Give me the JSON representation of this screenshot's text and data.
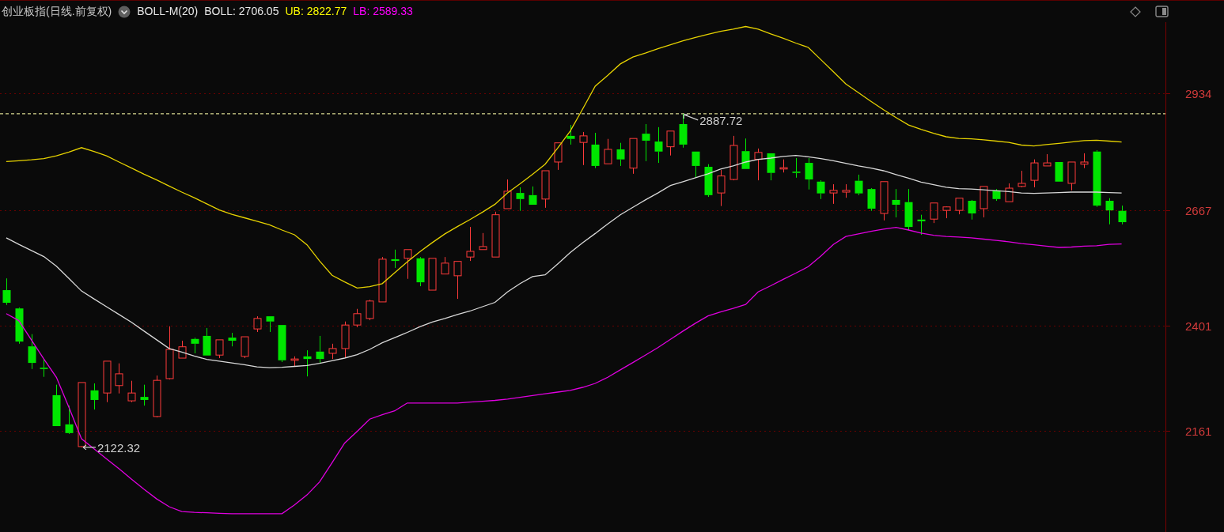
{
  "header": {
    "title": "创业板指(日线.前复权)",
    "indicator": "BOLL-M(20)",
    "readings": [
      {
        "text": "BOLL: 2706.05",
        "color": "#e8e8e8"
      },
      {
        "text": "UB: 2822.77",
        "color": "#ffff00"
      },
      {
        "text": "LB: 2589.33",
        "color": "#ff00ff"
      }
    ]
  },
  "chart": {
    "chart_data": {
      "type": "candlestick",
      "ylim": [
        1928,
        3098
      ],
      "yticks": [
        2161,
        2401,
        2667,
        2934
      ],
      "grid": true,
      "categories": [
        null,
        null,
        null,
        null,
        null,
        null,
        null,
        null,
        null,
        null,
        null,
        null,
        null,
        null,
        null,
        null,
        null,
        null,
        null,
        null,
        null,
        null,
        null,
        null,
        null,
        null,
        null,
        null,
        null,
        null,
        null,
        null,
        null,
        null,
        null,
        null,
        null,
        null,
        null,
        null,
        null,
        null,
        null,
        null,
        null,
        null,
        null,
        null,
        null,
        null,
        null,
        null,
        null,
        null,
        null,
        null,
        null,
        null,
        null,
        null,
        null,
        null,
        null,
        null,
        null,
        null,
        null,
        null,
        null,
        null,
        null,
        null,
        null,
        null,
        null,
        null,
        null,
        null,
        null,
        null,
        null,
        null,
        null,
        null,
        null,
        null,
        null,
        null,
        null,
        null,
        null,
        null,
        null
      ],
      "ohlc": [
        [
          2483,
          2510,
          2449,
          2454
        ],
        [
          2441,
          2443,
          2360,
          2365
        ],
        [
          2354,
          2382,
          2302,
          2316
        ],
        [
          2305,
          2324,
          2284,
          2302
        ],
        [
          2242,
          2266,
          2171,
          2171
        ],
        [
          2175,
          2218,
          2153,
          2155
        ],
        [
          2124,
          2271,
          2122.32,
          2271
        ],
        [
          2253,
          2269,
          2209,
          2231
        ],
        [
          2247,
          2320,
          2226,
          2320
        ],
        [
          2264,
          2315,
          2246,
          2291
        ],
        [
          2229,
          2275,
          2226,
          2247
        ],
        [
          2238,
          2266,
          2218,
          2231
        ],
        [
          2193,
          2287,
          2191,
          2276
        ],
        [
          2280,
          2400,
          2278,
          2347
        ],
        [
          2327,
          2367,
          2327,
          2353
        ],
        [
          2371,
          2374,
          2338,
          2360
        ],
        [
          2378,
          2396,
          2333,
          2333
        ],
        [
          2334,
          2369,
          2327,
          2369
        ],
        [
          2374,
          2385,
          2354,
          2367
        ],
        [
          2331,
          2376,
          2327,
          2376
        ],
        [
          2394,
          2423,
          2387,
          2418
        ],
        [
          2423,
          2423,
          2387,
          2411
        ],
        [
          2403,
          2403,
          2318,
          2322
        ],
        [
          2322,
          2331,
          2307,
          2325
        ],
        [
          2331,
          2345,
          2285,
          2325
        ],
        [
          2342,
          2378,
          2315,
          2325
        ],
        [
          2338,
          2360,
          2325,
          2349
        ],
        [
          2349,
          2411,
          2329,
          2403
        ],
        [
          2403,
          2440,
          2398,
          2429
        ],
        [
          2418,
          2461,
          2414,
          2458
        ],
        [
          2456,
          2559,
          2456,
          2554
        ],
        [
          2554,
          2576,
          2534,
          2550
        ],
        [
          2556,
          2576,
          2509,
          2576
        ],
        [
          2556,
          2559,
          2492,
          2501
        ],
        [
          2483,
          2556,
          2483,
          2556
        ],
        [
          2520,
          2559,
          2520,
          2545
        ],
        [
          2516,
          2549,
          2463,
          2549
        ],
        [
          2559,
          2628,
          2550,
          2572
        ],
        [
          2576,
          2614,
          2576,
          2583
        ],
        [
          2559,
          2663,
          2559,
          2656
        ],
        [
          2670,
          2737,
          2670,
          2710
        ],
        [
          2706,
          2719,
          2665,
          2692
        ],
        [
          2701,
          2721,
          2679,
          2679
        ],
        [
          2692,
          2757,
          2672,
          2757
        ],
        [
          2777,
          2821,
          2759,
          2821
        ],
        [
          2837,
          2862,
          2817,
          2830
        ],
        [
          2822,
          2846,
          2770,
          2837
        ],
        [
          2817,
          2844,
          2763,
          2768
        ],
        [
          2773,
          2830,
          2773,
          2806
        ],
        [
          2806,
          2821,
          2768,
          2783
        ],
        [
          2763,
          2831,
          2750,
          2831
        ],
        [
          2842,
          2864,
          2779,
          2826
        ],
        [
          2824,
          2857,
          2775,
          2801
        ],
        [
          2812,
          2848,
          2792,
          2848
        ],
        [
          2864,
          2887.72,
          2810,
          2817
        ],
        [
          2801,
          2801,
          2741,
          2768
        ],
        [
          2766,
          2772,
          2697,
          2701
        ],
        [
          2706,
          2759,
          2676,
          2745
        ],
        [
          2737,
          2837,
          2735,
          2815
        ],
        [
          2802,
          2831,
          2761,
          2761
        ],
        [
          2783,
          2808,
          2735,
          2799
        ],
        [
          2797,
          2797,
          2735,
          2752
        ],
        [
          2761,
          2783,
          2753,
          2764
        ],
        [
          2755,
          2786,
          2741,
          2752
        ],
        [
          2775,
          2786,
          2714,
          2737
        ],
        [
          2732,
          2735,
          2692,
          2705
        ],
        [
          2706,
          2726,
          2681,
          2712
        ],
        [
          2708,
          2726,
          2695,
          2712
        ],
        [
          2734,
          2748,
          2701,
          2705
        ],
        [
          2715,
          2717,
          2665,
          2670
        ],
        [
          2659,
          2732,
          2643,
          2732
        ],
        [
          2690,
          2715,
          2650,
          2679
        ],
        [
          2685,
          2715,
          2621,
          2628
        ],
        [
          2645,
          2656,
          2610,
          2641
        ],
        [
          2646,
          2683,
          2637,
          2683
        ],
        [
          2666,
          2675,
          2648,
          2674
        ],
        [
          2666,
          2694,
          2657,
          2694
        ],
        [
          2688,
          2690,
          2645,
          2659
        ],
        [
          2670,
          2721,
          2650,
          2721
        ],
        [
          2712,
          2715,
          2688,
          2692
        ],
        [
          2686,
          2728,
          2686,
          2717
        ],
        [
          2721,
          2757,
          2719,
          2728
        ],
        [
          2735,
          2783,
          2719,
          2775
        ],
        [
          2768,
          2795,
          2768,
          2775
        ],
        [
          2777,
          2777,
          2732,
          2732
        ],
        [
          2728,
          2777,
          2712,
          2777
        ],
        [
          2772,
          2797,
          2763,
          2777
        ],
        [
          2801,
          2804,
          2674,
          2677
        ],
        [
          2688,
          2694,
          2634,
          2666
        ],
        [
          2665,
          2677,
          2634,
          2639
        ],
        null,
        null,
        null
      ],
      "series": [
        {
          "type": "line",
          "color": "#e6d200",
          "values": [
            2778,
            2780,
            2782,
            2785,
            2791,
            2800,
            2810,
            2801,
            2791,
            2777,
            2763,
            2749,
            2736,
            2722,
            2708,
            2695,
            2681,
            2667,
            2657,
            2649,
            2641,
            2633,
            2621,
            2610,
            2587,
            2550,
            2517,
            2502,
            2488,
            2491,
            2498,
            2523,
            2548,
            2571,
            2592,
            2612,
            2629,
            2645,
            2662,
            2680,
            2706,
            2727,
            2749,
            2772,
            2809,
            2848,
            2899,
            2951,
            2976,
            3002,
            3018,
            3027,
            3037,
            3046,
            3055,
            3063,
            3070,
            3077,
            3082,
            3088,
            3082,
            3071,
            3061,
            3050,
            3040,
            3012,
            2984,
            2956,
            2936,
            2916,
            2897,
            2879,
            2862,
            2852,
            2843,
            2835,
            2831,
            2830,
            2828,
            2825,
            2822,
            2816,
            2814,
            2817,
            2820,
            2823,
            2826,
            2827,
            2825,
            2823,
            null,
            null,
            null
          ]
        },
        {
          "type": "line",
          "color": "#d8d8d8",
          "values": [
            2603,
            2588,
            2574,
            2560,
            2538,
            2510,
            2481,
            2463,
            2445,
            2427,
            2409,
            2389,
            2369,
            2349,
            2341,
            2332,
            2324,
            2320,
            2316,
            2312,
            2307,
            2305,
            2306,
            2308,
            2310,
            2315,
            2321,
            2327,
            2335,
            2347,
            2362,
            2374,
            2386,
            2399,
            2410,
            2418,
            2427,
            2435,
            2445,
            2455,
            2479,
            2498,
            2514,
            2518,
            2543,
            2569,
            2592,
            2613,
            2635,
            2656,
            2673,
            2690,
            2706,
            2723,
            2732,
            2741,
            2750,
            2761,
            2768,
            2777,
            2783,
            2786,
            2790,
            2792,
            2789,
            2785,
            2780,
            2774,
            2768,
            2763,
            2757,
            2748,
            2740,
            2731,
            2725,
            2719,
            2716,
            2715,
            2713,
            2711,
            2709,
            2706,
            2705,
            2706,
            2707,
            2708,
            2708,
            2708,
            2707,
            2706,
            null,
            null,
            null
          ]
        },
        {
          "type": "line",
          "color": "#e000e0",
          "values": [
            2429,
            2413,
            2369,
            2325,
            2283,
            2214,
            2142,
            2119,
            2096,
            2073,
            2049,
            2026,
            2004,
            1986,
            1975,
            1973,
            1972,
            1971,
            1970,
            1970,
            1970,
            1970,
            1970,
            1990,
            2013,
            2043,
            2087,
            2132,
            2159,
            2187,
            2197,
            2206,
            2224,
            2224,
            2224,
            2224,
            2224,
            2226,
            2228,
            2230,
            2233,
            2237,
            2241,
            2245,
            2249,
            2253,
            2260,
            2269,
            2283,
            2300,
            2317,
            2334,
            2351,
            2370,
            2389,
            2407,
            2424,
            2433,
            2441,
            2450,
            2479,
            2493,
            2508,
            2522,
            2537,
            2561,
            2588,
            2606,
            2612,
            2618,
            2623,
            2627,
            2621,
            2614,
            2609,
            2606,
            2605,
            2603,
            2600,
            2597,
            2594,
            2590,
            2587,
            2584,
            2581,
            2582,
            2584,
            2585,
            2588,
            2589,
            null,
            null,
            null
          ]
        }
      ],
      "ref_lines": [
        {
          "axis": "y",
          "value": 2887.72
        }
      ],
      "annotations": [
        {
          "text": "2887.72"
        },
        {
          "text": "2122.32"
        }
      ]
    }
  }
}
